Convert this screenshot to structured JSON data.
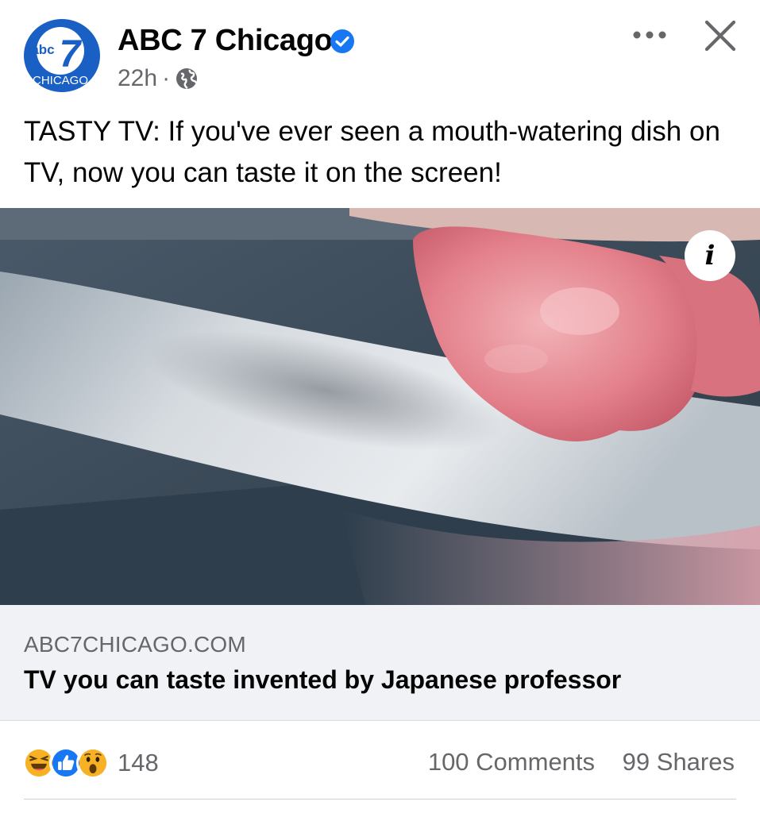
{
  "post": {
    "page_name": "ABC 7 Chicago",
    "verified": true,
    "timestamp": "22h",
    "separator": "·",
    "audience_icon": "globe-icon",
    "text": "TASTY TV: If you've ever seen a mouth-watering dish on TV, now you can taste it on the screen!"
  },
  "avatar": {
    "logo_text_top": "abc",
    "logo_number": "7",
    "logo_text_bottom": "CHICAGO"
  },
  "link_preview": {
    "domain": "ABC7CHICAGO.COM",
    "title": "TV you can taste invented by Japanese professor",
    "info_icon_label": "i"
  },
  "engagement": {
    "reactions": [
      "haha-icon",
      "like-icon",
      "wow-icon"
    ],
    "reaction_count": "148",
    "comments": "100 Comments",
    "shares": "99 Shares"
  },
  "colors": {
    "brand_blue": "#1a5fc4",
    "verified_blue": "#1877f2",
    "secondary_text": "#65676b",
    "link_bg": "#f0f2f5"
  }
}
